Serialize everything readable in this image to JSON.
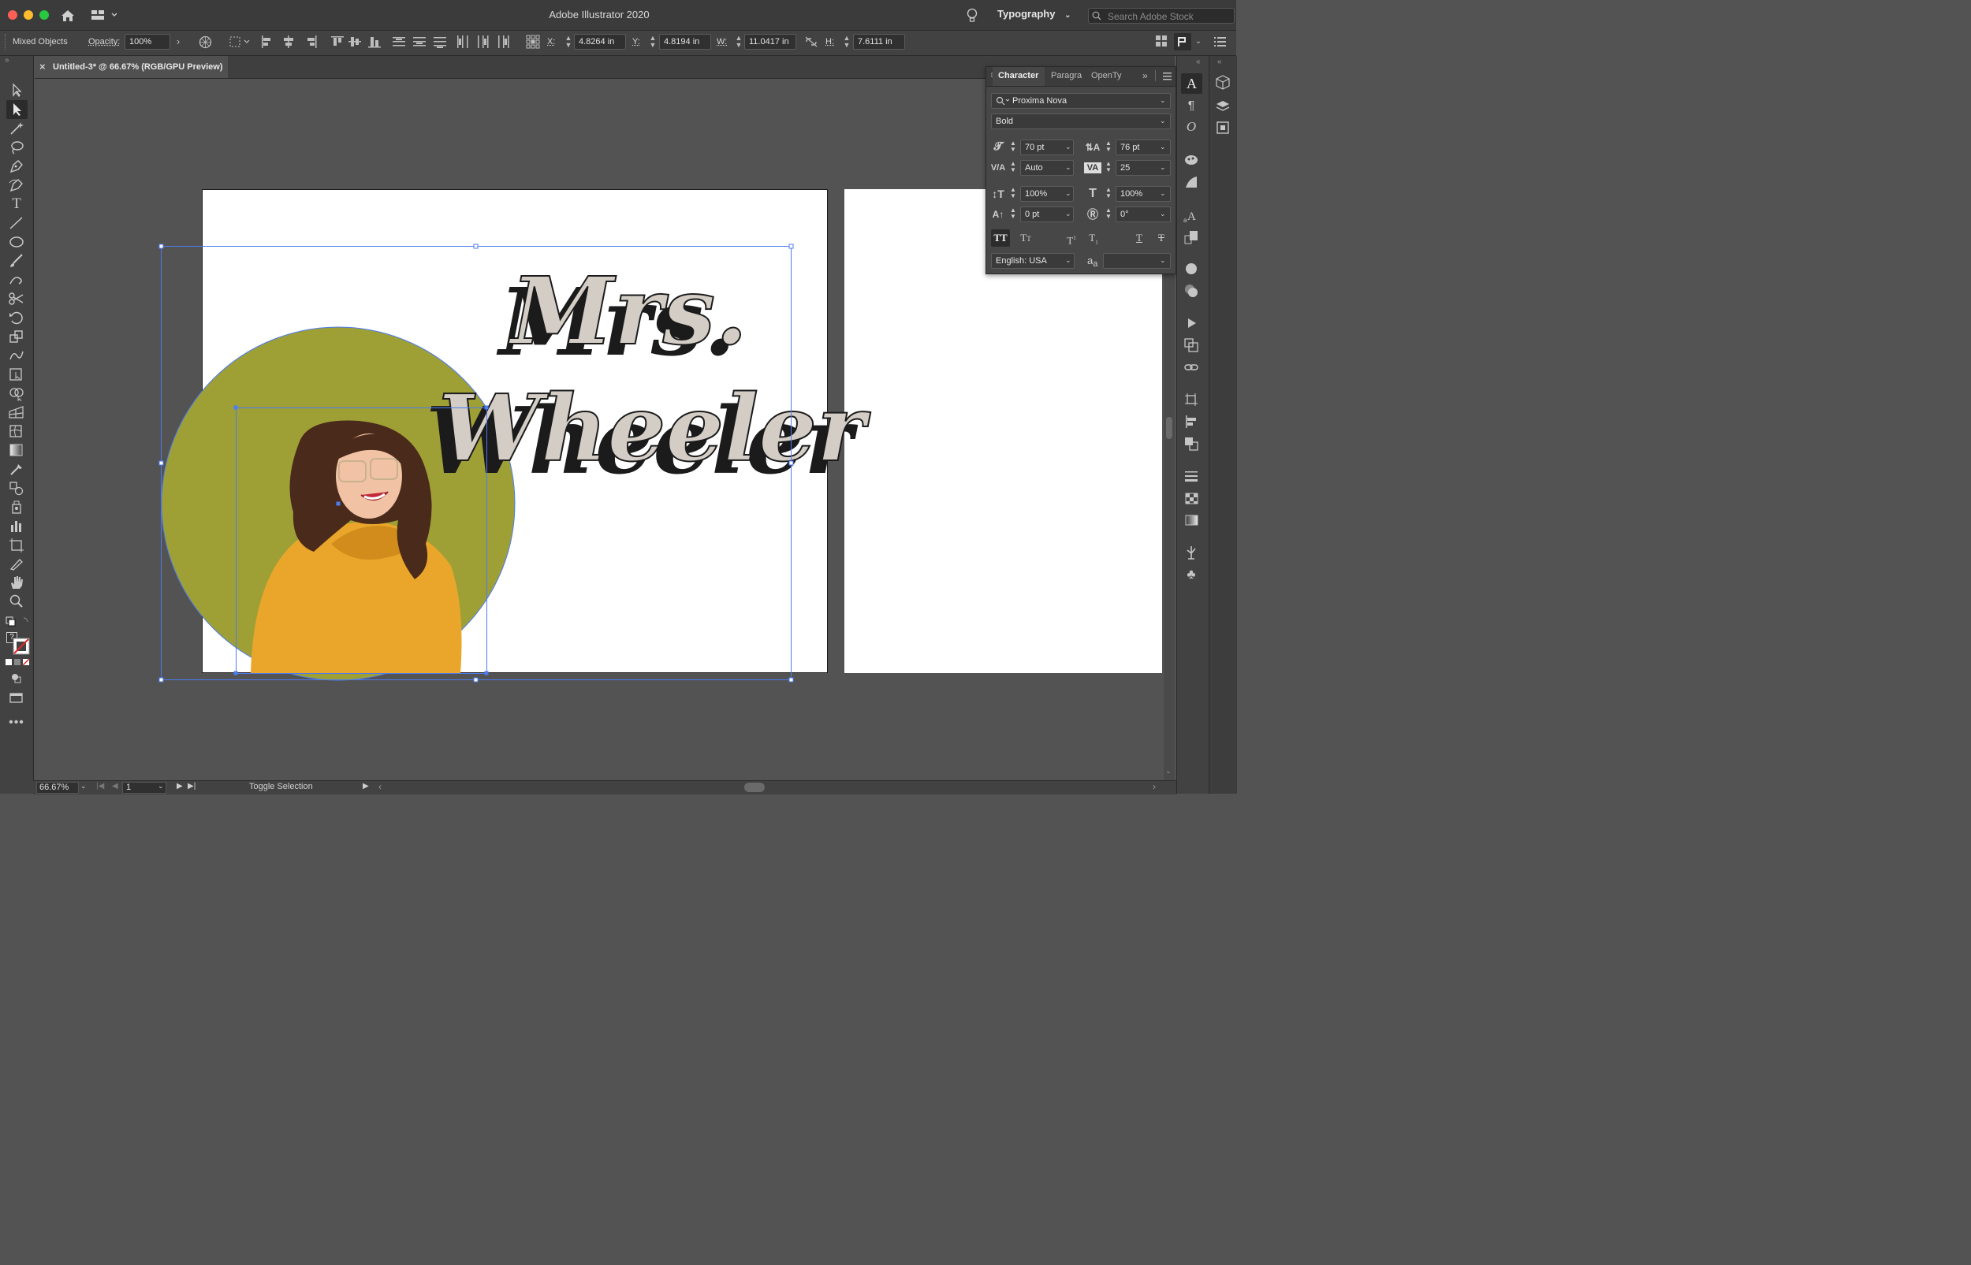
{
  "app": {
    "title": "Adobe Illustrator 2020",
    "workspace": "Typography",
    "stock_search_placeholder": "Search Adobe Stock"
  },
  "control_bar": {
    "selection_type": "Mixed Objects",
    "opacity_label": "Opacity:",
    "opacity_value": "100%",
    "x_label": "X:",
    "x_value": "4.8264 in",
    "y_label": "Y:",
    "y_value": "4.8194 in",
    "w_label": "W:",
    "w_value": "11.0417 in",
    "h_label": "H:",
    "h_value": "7.6111 in"
  },
  "document": {
    "tab_title": "Untitled-3* @ 66.67% (RGB/GPU Preview)",
    "headline_line1": "Mrs.",
    "headline_line2": "Wheeler"
  },
  "character_panel": {
    "tabs": [
      "Character",
      "Paragraph",
      "OpenType"
    ],
    "tab_labels_visible": [
      "Character",
      "Paragra",
      "OpenTy"
    ],
    "font_family": "Proxima Nova",
    "font_style": "Bold",
    "font_size": "70 pt",
    "leading": "76 pt",
    "kerning": "Auto",
    "tracking": "25",
    "vertical_scale": "100%",
    "horizontal_scale": "100%",
    "baseline_shift": "0 pt",
    "rotation": "0°",
    "language": "English: USA",
    "aa_label": "a"
  },
  "status_bar": {
    "zoom": "66.67%",
    "artboard_number": "1",
    "status_text": "Toggle Selection"
  },
  "colors": {
    "circle_fill": "#9ea036",
    "text_fill": "#d3cdc5",
    "text_shadow": "#1b1b1b",
    "selection": "#4d7bf0",
    "sweater": "#e9a62a",
    "hair": "#4a2a1a"
  }
}
